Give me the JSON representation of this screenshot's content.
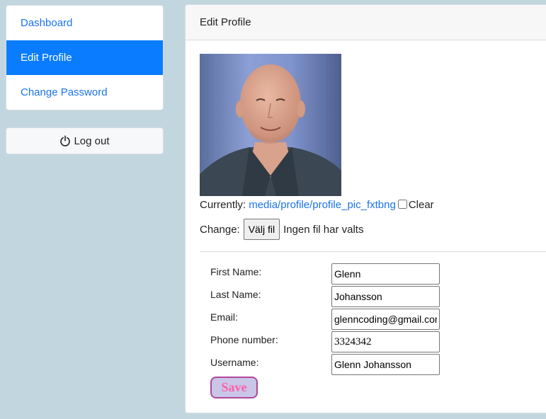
{
  "sidebar": {
    "items": [
      {
        "label": "Dashboard",
        "active": false
      },
      {
        "label": "Edit Profile",
        "active": true
      },
      {
        "label": "Change Password",
        "active": false
      }
    ],
    "logout_label": "Log out",
    "logout_icon": "power-icon"
  },
  "card": {
    "title": "Edit Profile",
    "photo": {
      "currently_label": "Currently:",
      "current_file": "media/profile/profile_pic_fxtbng",
      "clear_label": "Clear",
      "change_label": "Change:",
      "choose_file_button": "Välj fil",
      "no_file_text": "Ingen fil har valts"
    },
    "form": {
      "first_name": {
        "label": "First Name:",
        "value": "Glenn"
      },
      "last_name": {
        "label": "Last Name:",
        "value": "Johansson"
      },
      "email": {
        "label": "Email:",
        "value": "glenncoding@gmail.com"
      },
      "phone": {
        "label": "Phone number:",
        "value": "3324342"
      },
      "username": {
        "label": "Username:",
        "value": "Glenn Johansson"
      },
      "save_label": "Save"
    }
  },
  "colors": {
    "background": "#c2d6df",
    "active_nav": "#0a7cff",
    "link": "#1a73e8",
    "save_text": "#ff5fa9",
    "save_border": "#b0479b",
    "save_bg": "#c9c6e8"
  }
}
